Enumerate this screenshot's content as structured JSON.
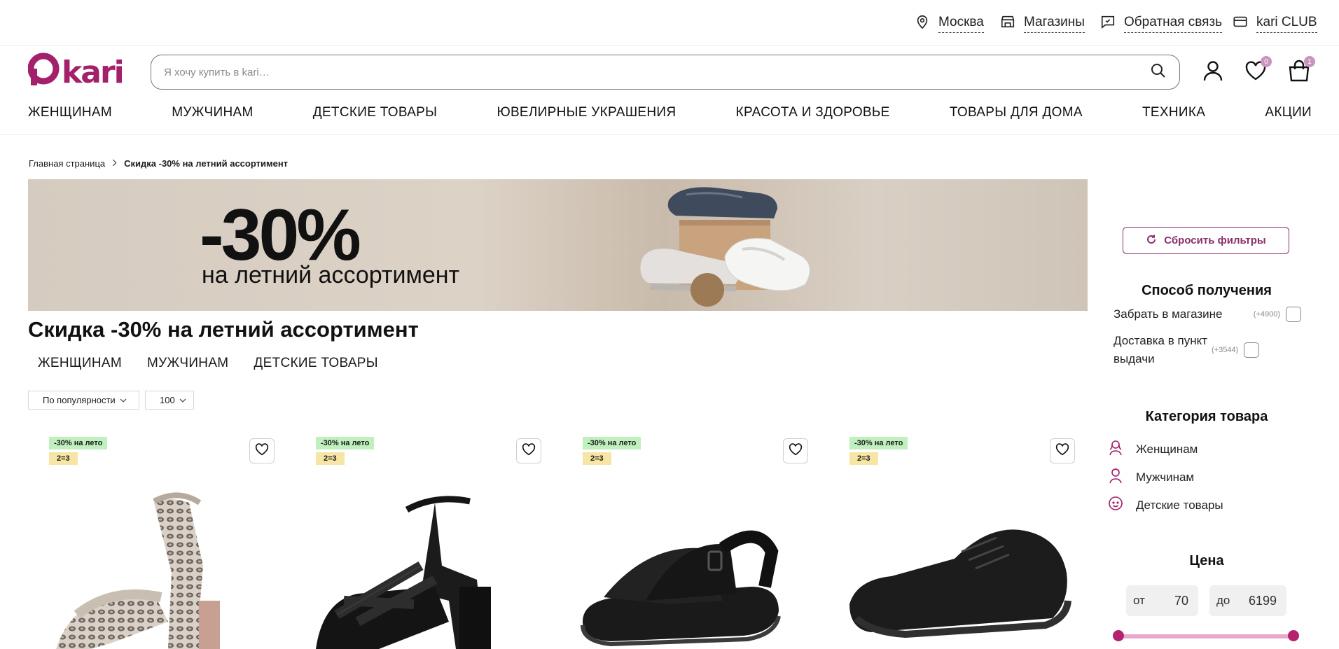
{
  "topbar": {
    "city": "Москва",
    "stores": "Магазины",
    "feedback": "Обратная связь",
    "club": "kari CLUB"
  },
  "header": {
    "logo_text": "kari",
    "search_placeholder": "Я хочу купить в kari…",
    "favorites_count": "0",
    "cart_count": "1",
    "brand_color": "#a3216b"
  },
  "nav": {
    "items": [
      "ЖЕНЩИНАМ",
      "МУЖЧИНАМ",
      "ДЕТСКИЕ ТОВАРЫ",
      "ЮВЕЛИРНЫЕ УКРАШЕНИЯ",
      "КРАСОТА И ЗДОРОВЬЕ",
      "ТОВАРЫ ДЛЯ ДОМА",
      "ТЕХНИКА",
      "АКЦИИ"
    ]
  },
  "breadcrumb": {
    "home": "Главная страница",
    "current": "Скидка -30% на летний ассортимент"
  },
  "banner": {
    "big": "-30%",
    "sub": "на летний ассортимент"
  },
  "page": {
    "title": "Скидка -30% на летний ассортимент",
    "category_tabs": [
      "ЖЕНЩИНАМ",
      "МУЖЧИНАМ",
      "ДЕТСКИЕ ТОВАРЫ"
    ],
    "sort_value": "По популярности",
    "per_page_value": "100"
  },
  "products": [
    {
      "tag1": "-30% на лето",
      "tag2": "2=3",
      "image": "snake-print-heeled-sandal"
    },
    {
      "tag1": "-30% на лето",
      "tag2": "2=3",
      "image": "black-strappy-heeled-sandal"
    },
    {
      "tag1": "-30% на лето",
      "tag2": "2=3",
      "image": "black-flat-sandal"
    },
    {
      "tag1": "-30% на лето",
      "tag2": "2=3",
      "image": "black-knit-sneaker"
    }
  ],
  "filters": {
    "reset_label": "Сбросить фильтры",
    "delivery_title": "Способ получения",
    "delivery": [
      {
        "label": "Забрать в магазине",
        "count": "(+4900)"
      },
      {
        "label": "Доставка в пункт выдачи",
        "count": "(+3544)"
      }
    ],
    "category_title": "Категория товара",
    "categories": [
      {
        "label": "Женщинам",
        "icon": "woman-icon"
      },
      {
        "label": "Мужчинам",
        "icon": "man-icon"
      },
      {
        "label": "Детские товары",
        "icon": "child-icon"
      }
    ],
    "price_title": "Цена",
    "price_from_label": "от",
    "price_from": "70",
    "price_to_label": "до",
    "price_to": "6199"
  }
}
